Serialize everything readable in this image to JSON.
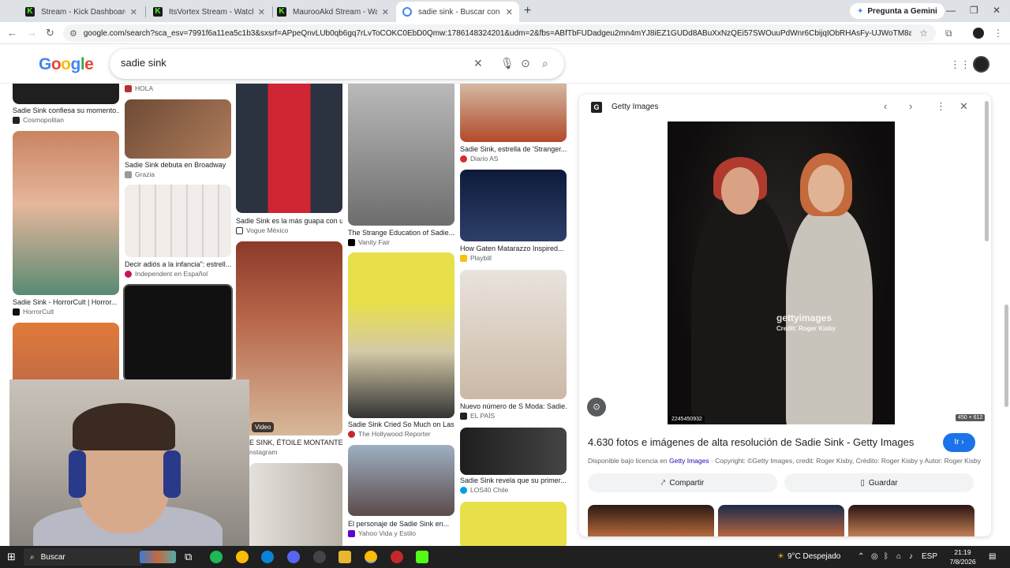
{
  "browser": {
    "tabs": [
      {
        "label": "Stream - Kick Dashboard",
        "close": "✕"
      },
      {
        "label": "ItsVortex Stream - Watch Live o",
        "close": "✕"
      },
      {
        "label": "MaurooAkd Stream - Watch Live",
        "close": "✕"
      },
      {
        "label": "sadie sink - Buscar con Google",
        "close": "✕"
      }
    ],
    "new_tab": "+",
    "gemini_label": "Pregunta a Gemini",
    "url": "google.com/search?sca_esv=7991f6a11ea5c1b3&sxsrf=APpeQnvLUb0qb6gq7rLvToCOKC0EbD0Qmw:1786148324201&udm=2&fbs=ABfTbFUDadgeu2mn4mYJ8iEZ1GUDd8ABuXxNzQEi57SWOuuPdWnr6CbijqIObRHAsFy-UJWoTM8aZIBG_34I3eK4-VpJ3FW..."
  },
  "google": {
    "logo": [
      "G",
      "o",
      "o",
      "g",
      "l",
      "e"
    ],
    "query": "sadie sink"
  },
  "results": [
    {
      "caption": "Sadie Sink confiesa su momento...",
      "source": "Cosmopolitan",
      "color": "#c3a3a0"
    },
    {
      "caption": "",
      "source": "HOLA",
      "color": "#b92f2f"
    },
    {
      "caption": "Sadie Sink debuta en Broadway",
      "source": "Grazia",
      "color": "#8b5e3c"
    },
    {
      "caption": "Decir adiós a la infancia\": estrell...",
      "source": "Independent en Español",
      "color": "#d8d3cf"
    },
    {
      "caption": "Sadie Sink es la más guapa con u...",
      "source": "Vogue México",
      "color": "#c9222b"
    },
    {
      "caption": "The Strange Education of Sadie...",
      "source": "Vanity Fair",
      "color": "#8a8a8a"
    },
    {
      "caption": "Sadie Sink, estrella de 'Stranger...",
      "source": "Diario AS",
      "color": "#b24a2a"
    },
    {
      "caption": "How Gaten Matarazzo Inspired...",
      "source": "Playbill",
      "color": "#1c2a4a"
    },
    {
      "caption": "Sadie Sink - HorrorCult | Horror...",
      "source": "HorrorCult",
      "color": "#d9a98f"
    },
    {
      "caption": "Sadie Sink Cried So Much on Las...",
      "source": "The Hollywood Reporter",
      "color": "#e8e04a"
    },
    {
      "caption": "Nuevo número de S Moda: Sadie...",
      "source": "EL PAÍS",
      "color": "#d8cfc4"
    },
    {
      "caption": "E SINK, ÉTOILE MONTANTE...",
      "source": "nstagram",
      "color": "#8c3b2c"
    },
    {
      "caption": "Sadie Sink revela que su primer...",
      "source": "LOS40 Chile",
      "color": "#2a2a2a"
    },
    {
      "caption": "El personaje de Sadie Sink en...",
      "source": "Yahoo Vida y Estilo",
      "color": "#6a7b8a"
    }
  ],
  "video_badge": "Video",
  "panel": {
    "source": "Getty Images",
    "watermark": "gettyimages",
    "credit": "Credit: Roger Kisby",
    "image_id": "2245450932",
    "dims": "450 × 612",
    "title": "4.630 fotos e imágenes de alta resolución de Sadie Sink - Getty Images",
    "go_label": "Ir",
    "license_prefix": "Disponible bajo licencia en",
    "license_link": "Getty Images",
    "license_rest": "· Copyright: ©Getty Images, credit: Roger Kisby, Crédito: Roger Kisby y Autor: Roger Kisby",
    "share_label": "Compartir",
    "save_label": "Guardar"
  },
  "taskbar": {
    "search_label": "Buscar",
    "weather": "9°C  Despejado",
    "lang": "ESP",
    "time": "21:19",
    "date": "7/8/2026"
  },
  "colors": {
    "accent": "#1a73e8",
    "kick_green": "#53fc18"
  }
}
